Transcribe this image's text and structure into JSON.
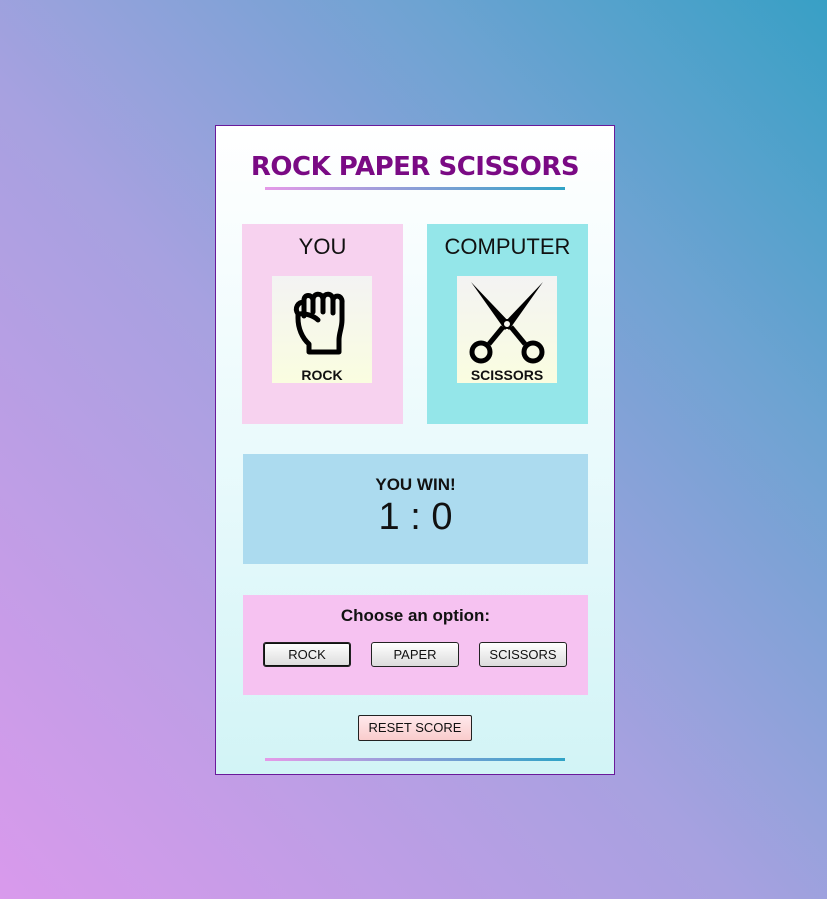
{
  "header": {
    "title": "ROCK PAPER SCISSORS"
  },
  "players": {
    "you": {
      "label": "YOU",
      "choice_label": "ROCK",
      "choice_icon": "rock-fist-icon"
    },
    "computer": {
      "label": "COMPUTER",
      "choice_label": "SCISSORS",
      "choice_icon": "scissors-icon"
    }
  },
  "result": {
    "message": "YOU WIN!",
    "score": "1 : 0"
  },
  "options": {
    "title": "Choose an option:",
    "buttons": [
      "ROCK",
      "PAPER",
      "SCISSORS"
    ]
  },
  "controls": {
    "reset_label": "RESET SCORE"
  },
  "colors": {
    "title": "#7a0a84",
    "you_panel": "#f7d2ef",
    "computer_panel": "#94e6e9",
    "result_panel": "#acdbef",
    "options_panel": "#f6c2f1"
  }
}
